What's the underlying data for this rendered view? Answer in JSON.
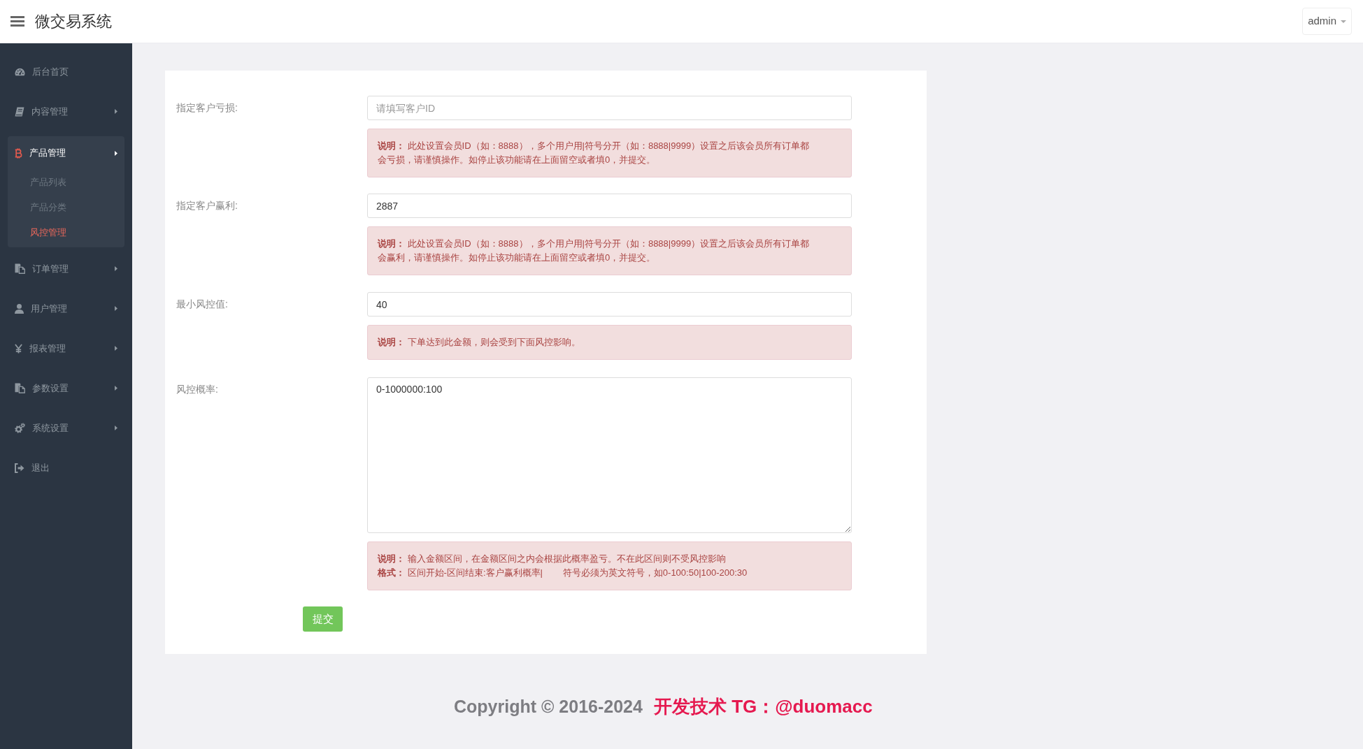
{
  "header": {
    "title": "微交易系统",
    "user_menu": "admin"
  },
  "sidebar": {
    "items": [
      {
        "label": "后台首页",
        "selected": false,
        "expanded": false,
        "has_submenu": false
      },
      {
        "label": "内容管理",
        "selected": false,
        "expanded": false,
        "has_submenu": true
      },
      {
        "label": "产品管理",
        "selected": true,
        "expanded": true,
        "has_submenu": true,
        "children": [
          {
            "label": "产品列表",
            "selected": false
          },
          {
            "label": "产品分类",
            "selected": false
          },
          {
            "label": "风控管理",
            "selected": true
          }
        ]
      },
      {
        "label": "订单管理",
        "selected": false,
        "expanded": false,
        "has_submenu": true
      },
      {
        "label": "用户管理",
        "selected": false,
        "expanded": false,
        "has_submenu": true
      },
      {
        "label": "报表管理",
        "selected": false,
        "expanded": false,
        "has_submenu": true
      },
      {
        "label": "参数设置",
        "selected": false,
        "expanded": false,
        "has_submenu": true
      },
      {
        "label": "系统设置",
        "selected": false,
        "expanded": false,
        "has_submenu": true
      },
      {
        "label": "退出",
        "selected": false,
        "expanded": false,
        "has_submenu": false
      }
    ]
  },
  "form": {
    "fields": [
      {
        "kind": "input",
        "label": "指定客户亏损:",
        "placeholder": "请填写客户ID",
        "note": [
          "**说明：** 此处设置会员ID（如：8888），多个用户用|符号分开（如：8888|9999）设置之后该会员所有订单都会亏损，请谨慎操作。如停止该功能请在上面留空或者填0，并提交。"
        ]
      },
      {
        "kind": "input",
        "label": "指定客户赢利:",
        "value": "2887",
        "note": [
          "**说明：** 此处设置会员ID（如：8888），多个用户用|符号分开（如：8888|9999）设置之后该会员所有订单都会赢利，请谨慎操作。如停止该功能请在上面留空或者填0，并提交。"
        ]
      },
      {
        "kind": "input",
        "label": "最小风控值:",
        "value": "40",
        "note": [
          "**说明：** 下单达到此金额，则会受到下面风控影响。"
        ]
      },
      {
        "kind": "textarea",
        "label": "风控概率:",
        "value": "0-1000000:100",
        "note": [
          "**说明：** 输入金额区间，在金额区间之内会根据此概率盈亏。不在此区间则不受风控影响",
          "**格式：** 区间开始-区间结束:客户赢利概率|        符号必须为英文符号，如0-100:50|100-200:30"
        ]
      }
    ],
    "submit": "提交"
  },
  "footer": {
    "copyright": "Copyright © 2016-2024",
    "credit": "开发技术 TG：@duomacc"
  }
}
